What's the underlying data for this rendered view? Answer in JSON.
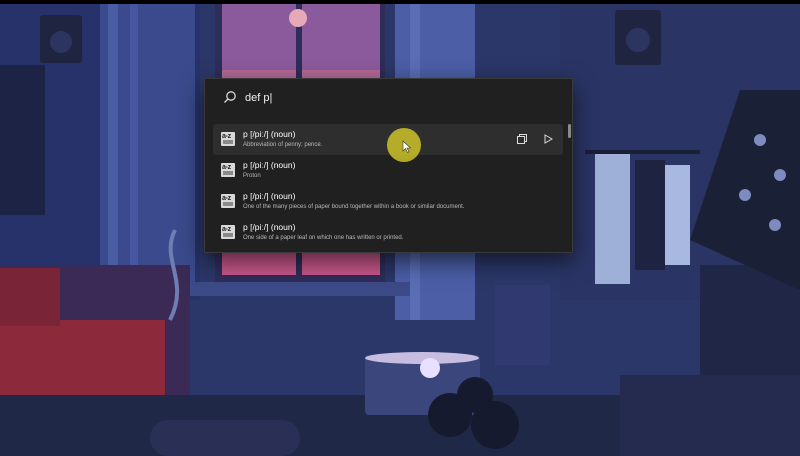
{
  "search": {
    "query": "def p|"
  },
  "results": [
    {
      "title": "p [/piː/] (noun)",
      "subtitle": "Abbreviation of penny; pence.",
      "selected": true
    },
    {
      "title": "p [/piː/] (noun)",
      "subtitle": "Proton",
      "selected": false
    },
    {
      "title": "p [/piː/] (noun)",
      "subtitle": "One of the many pieces of paper bound together within a book or similar document.",
      "selected": false
    },
    {
      "title": "p [/piː/] (noun)",
      "subtitle": "One side of a paper leaf on which one has written or printed.",
      "selected": false
    }
  ],
  "result_icon_text": "a-z",
  "colors": {
    "wallpaper_base": "#2b3768",
    "window_glow": "#c8578a",
    "launcher_bg": "#202020",
    "selected_row": "#2e2e2e",
    "cursor_halo": "#cdc328"
  },
  "icons": {
    "search": "search-icon",
    "copy": "copy-icon",
    "run": "play-icon",
    "result": "dictionary-icon"
  }
}
